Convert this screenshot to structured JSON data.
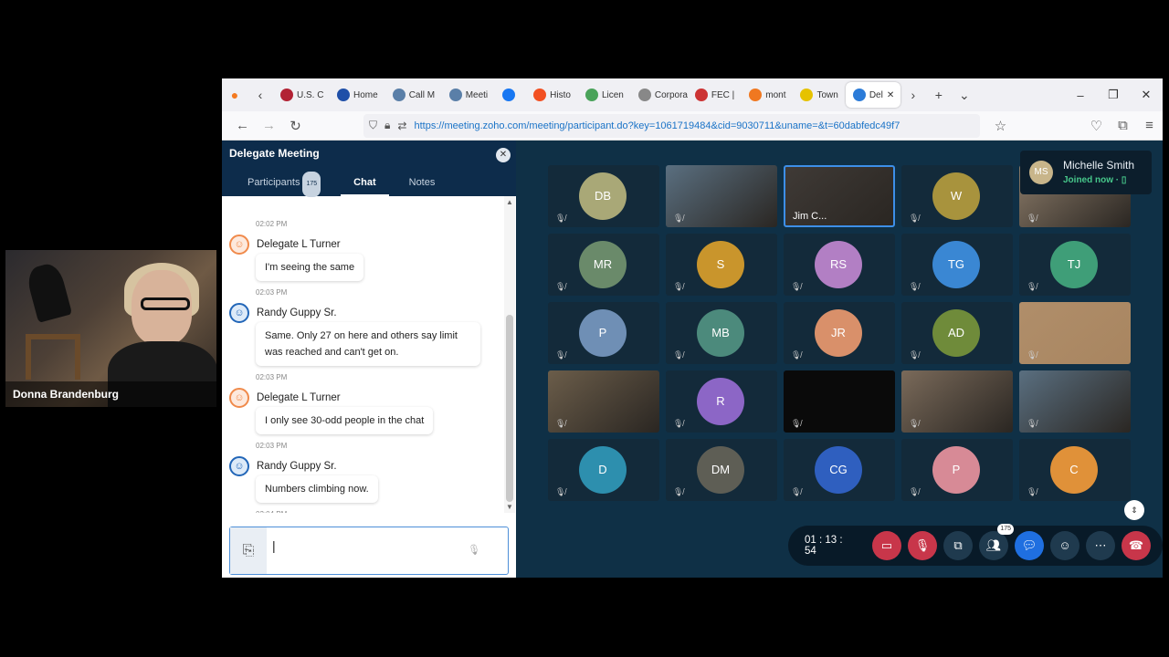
{
  "webcam": {
    "name": "Donna Brandenburg"
  },
  "browser": {
    "tabs": [
      "U.S. C",
      "Home",
      "Call M",
      "Meeti",
      "",
      "Histo",
      "Licen",
      "Corporati",
      "FEC |",
      "mont",
      "Town",
      "Del"
    ],
    "tab_colors": [
      "#b22234",
      "#1f4fa8",
      "#5a7fa8",
      "#5a7fa8",
      "#1877f2",
      "#f25022",
      "#4aa35a",
      "#888888",
      "#c33",
      "#f07820",
      "#e6c200",
      "#2b7bd8"
    ],
    "url": "https://meeting.zoho.com/meeting/participant.do?key=1061719484&cid=9030711&uname=&t=60dabfedc49f7"
  },
  "panel": {
    "title": "Delegate Meeting",
    "tabs": {
      "participants": "Participants",
      "participants_count": "175",
      "chat": "Chat",
      "notes": "Notes"
    },
    "messages": [
      {
        "time": "02:02 PM"
      },
      {
        "sender": "Delegate L Turner",
        "avatar": "orange",
        "text": "I'm seeing the same",
        "time": "02:03 PM"
      },
      {
        "sender": "Randy Guppy Sr.",
        "avatar": "blue",
        "text": "Same. Only 27 on here and others say limit was reached and can't get on.",
        "time": "02:03 PM"
      },
      {
        "sender": "Delegate L Turner",
        "avatar": "orange",
        "text": "I only see 30-odd people in the chat",
        "time": "02:03 PM"
      },
      {
        "sender": "Randy Guppy Sr.",
        "avatar": "blue",
        "text": "Numbers climbing now.",
        "time": "02:04 PM"
      }
    ]
  },
  "stage": {
    "tiles": [
      {
        "label": "DB",
        "color": "#a9a877"
      },
      {
        "label": "",
        "video": true
      },
      {
        "label": "Jim C...",
        "video": true,
        "selected": true
      },
      {
        "label": "W",
        "color": "#a8933d"
      },
      {
        "label": "",
        "video": true
      },
      {
        "label": "MR",
        "color": "#6a8a6a"
      },
      {
        "label": "S",
        "color": "#c9952c"
      },
      {
        "label": "RS",
        "color": "#b27fc4"
      },
      {
        "label": "TG",
        "color": "#3a87d3"
      },
      {
        "label": "TJ",
        "color": "#3f9e78"
      },
      {
        "label": "P",
        "color": "#6f8fb5"
      },
      {
        "label": "MB",
        "color": "#4c8a7c"
      },
      {
        "label": "JR",
        "color": "#d9906a"
      },
      {
        "label": "AD",
        "color": "#6f8b3a"
      },
      {
        "label": "",
        "video": true
      },
      {
        "label": "",
        "video": true
      },
      {
        "label": "R",
        "color": "#8c66c6"
      },
      {
        "label": "",
        "video": true
      },
      {
        "label": "",
        "video": true
      },
      {
        "label": "",
        "video": true
      },
      {
        "label": "D",
        "color": "#2d8fae"
      },
      {
        "label": "DM",
        "color": "#5e5e55"
      },
      {
        "label": "CG",
        "color": "#2f5fbf"
      },
      {
        "label": "P",
        "color": "#d78a96"
      },
      {
        "label": "C",
        "color": "#e09139"
      }
    ],
    "notice": {
      "initials": "MS",
      "name": "Michelle Smith",
      "status": "Joined now"
    }
  },
  "controls": {
    "timer": "01 : 13 : 54",
    "participants_badge": "175",
    "colors": {
      "danger": "#c8364a",
      "chat": "#1f6fe0",
      "neutral": "#1f3a4e"
    }
  }
}
